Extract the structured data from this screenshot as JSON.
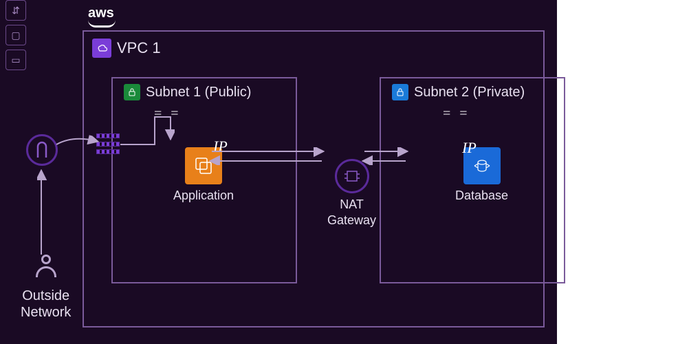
{
  "brand": "aws",
  "vpc": {
    "title": "VPC 1",
    "icon_name": "vpc-icon"
  },
  "subnets": [
    {
      "title": "Subnet 1 (Public)",
      "icon_color": "green",
      "node": {
        "label": "Application",
        "icon": "application-icon",
        "ip_annotation": "IP"
      }
    },
    {
      "title": "Subnet 2 (Private)",
      "icon_color": "blue",
      "node": {
        "label": "Database",
        "icon": "database-icon",
        "ip_annotation": "IP"
      }
    }
  ],
  "nat": {
    "label_line1": "NAT",
    "label_line2": "Gateway"
  },
  "outside": {
    "label_line1": "Outside",
    "label_line2": "Network",
    "gateway_icon": "internet-gateway-icon"
  },
  "colors": {
    "bg": "#1a0a24",
    "border": "#7a5a9a",
    "orange": "#e8801a",
    "blue": "#1a6ad8",
    "green": "#1a8a3a",
    "purple": "#7a3dd8"
  }
}
